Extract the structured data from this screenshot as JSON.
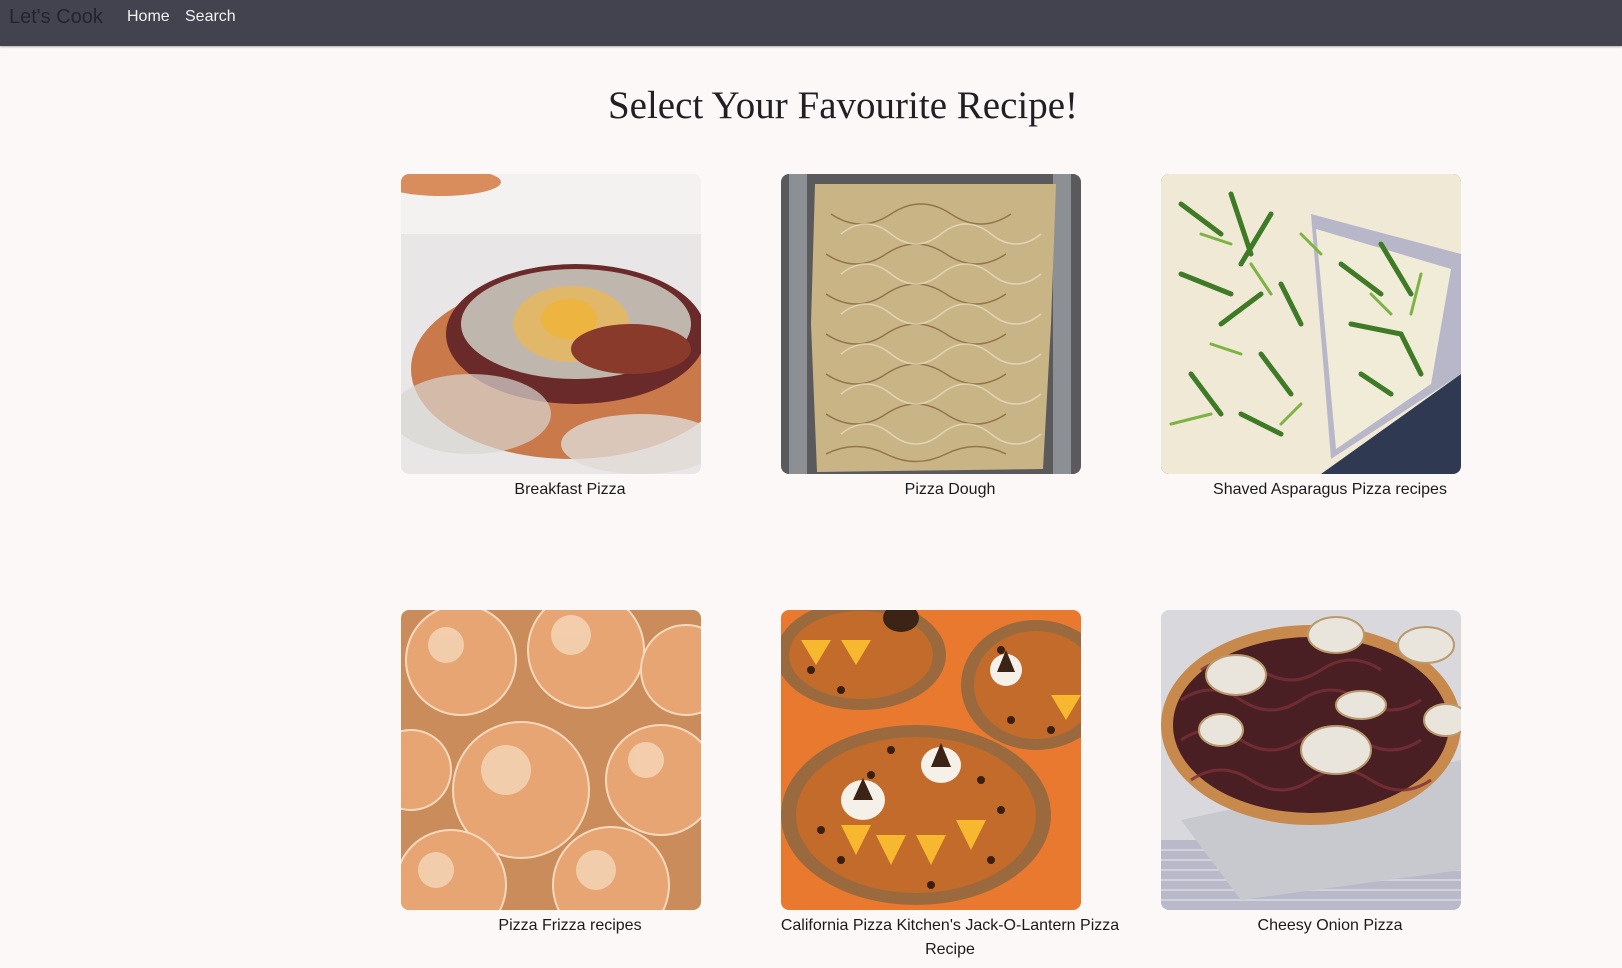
{
  "nav": {
    "brand": "Let's Cook",
    "links": [
      "Home",
      "Search"
    ]
  },
  "page": {
    "title": "Select Your Favourite Recipe!"
  },
  "recipes": [
    {
      "title": "Breakfast Pizza"
    },
    {
      "title": "Pizza Dough"
    },
    {
      "title": "Shaved Asparagus Pizza recipes"
    },
    {
      "title": "Pizza Frizza recipes"
    },
    {
      "title": "California Pizza Kitchen's Jack-O-Lantern Pizza Recipe"
    },
    {
      "title": "Cheesy Onion Pizza"
    }
  ],
  "colors": {
    "navbar": "#434350",
    "background": "#fdf8f8",
    "brand_text": "#24242c",
    "nav_text": "#f2f2f2"
  }
}
